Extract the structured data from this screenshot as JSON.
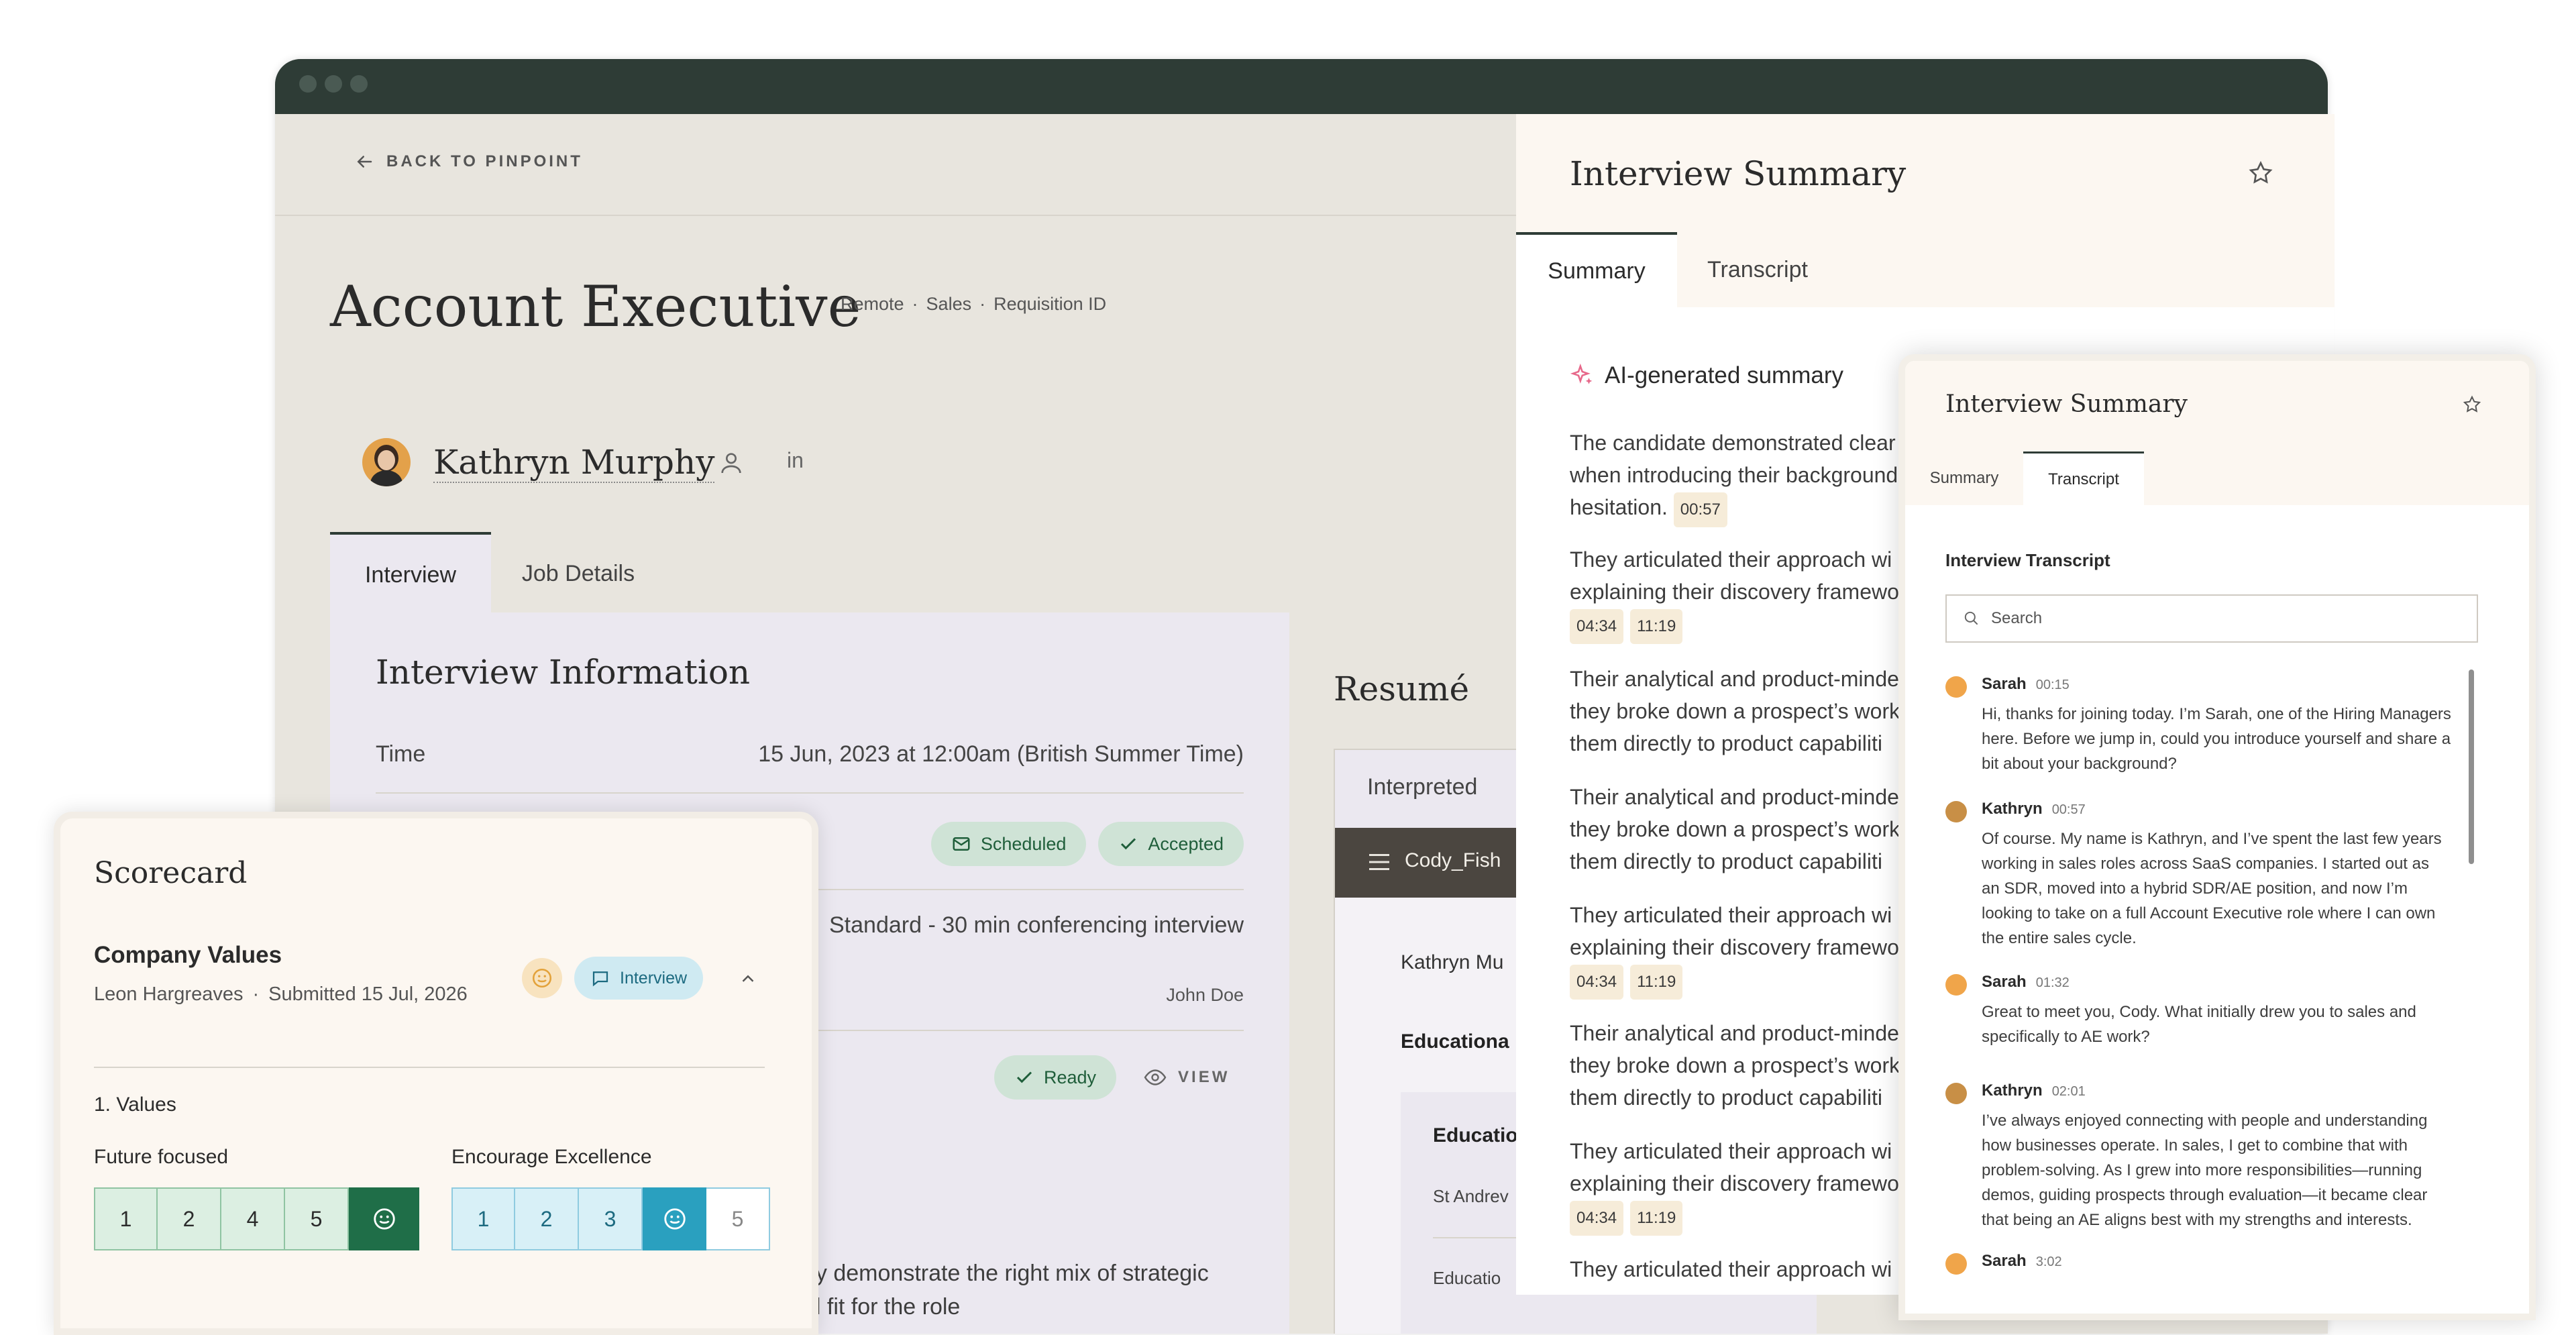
{
  "nav": {
    "back_label": "BACK TO PINPOINT"
  },
  "job": {
    "title": "Account Executive",
    "meta": [
      "Remote",
      "Sales",
      "Requisition ID"
    ]
  },
  "candidate": {
    "name": "Kathryn Murphy",
    "linkedin": "in"
  },
  "tabs": [
    "Interview",
    "Job Details"
  ],
  "interview_info": {
    "title": "Interview Information",
    "time_label": "Time",
    "time_value": "15 Jun, 2023 at 12:00am (British Summer Time)",
    "status_scheduled": "Scheduled",
    "status_accepted": "Accepted",
    "format_value": "Standard - 30 min conferencing interview",
    "interviewer": "John Doe",
    "ready_label": "Ready",
    "view_label": "VIEW",
    "partial_line1": "ey demonstrate the right mix of strategic",
    "partial_line2": "al fit for the role"
  },
  "resume": {
    "title": "Resumé",
    "tab": "Interpreted",
    "file": "Cody_Fish",
    "row1": "Kathryn Mu",
    "row2": "Educationa",
    "edu_head": "Educatio",
    "edu_row": "St Andrev",
    "edu_row2": "Educatio"
  },
  "summary_panel": {
    "title": "Interview Summary",
    "tabs": [
      "Summary",
      "Transcript"
    ],
    "ai_label": "AI-generated summary",
    "paragraphs": [
      {
        "lines": [
          "The candidate demonstrated clear",
          "when introducing their background",
          "hesitation."
        ],
        "times": [
          "00:57"
        ]
      },
      {
        "lines": [
          "They articulated their approach wi",
          "explaining their discovery framewo"
        ],
        "times": [
          "04:34",
          "11:19"
        ]
      },
      {
        "lines": [
          "Their analytical and product-minde",
          "they broke down a prospect’s work",
          "them directly to product capabiliti"
        ],
        "times": []
      },
      {
        "lines": [
          "Their analytical and product-minde",
          "they broke down a prospect’s work",
          "them directly to product capabiliti"
        ],
        "times": []
      },
      {
        "lines": [
          "They articulated their approach wi",
          "explaining their discovery framewo"
        ],
        "times": [
          "04:34",
          "11:19"
        ]
      },
      {
        "lines": [
          "Their analytical and product-minde",
          "they broke down a prospect’s work",
          "them directly to product capabiliti"
        ],
        "times": []
      },
      {
        "lines": [
          "They articulated their approach wi",
          "explaining their discovery framewo"
        ],
        "times": [
          "04:34",
          "11:19"
        ]
      },
      {
        "lines": [
          "They articulated their approach wi"
        ],
        "times": []
      }
    ]
  },
  "transcript_panel": {
    "title": "Interview Summary",
    "tabs": [
      "Summary",
      "Transcript"
    ],
    "heading": "Interview Transcript",
    "search_placeholder": "Search",
    "messages": [
      {
        "speaker": "Sarah",
        "time": "00:15",
        "text": "Hi, thanks for joining today. I’m Sarah, one of the Hiring Managers here. Before we jump in, could you introduce yourself and share a bit about your background?"
      },
      {
        "speaker": "Kathryn",
        "time": "00:57",
        "text": "Of course. My name is Kathryn, and I’ve spent the last few years working in sales roles across SaaS companies. I started out as an SDR, moved into a hybrid SDR/AE position, and now I’m looking to take on a full Account Executive role where I can own the entire sales cycle."
      },
      {
        "speaker": "Sarah",
        "time": "01:32",
        "text": "Great to meet you, Cody. What initially drew you to sales and specifically to AE work?"
      },
      {
        "speaker": "Kathryn",
        "time": "02:01",
        "text": "I’ve always enjoyed connecting with people and understanding how businesses operate. In sales, I get to combine that with problem-solving. As I grew into more responsibilities—running demos, guiding prospects through evaluation—it became clear that being an AE aligns best with my strengths and interests."
      },
      {
        "speaker": "Sarah",
        "time": "3:02",
        "text": ""
      }
    ]
  },
  "scorecard": {
    "title": "Scorecard",
    "section": "Company Values",
    "reviewer": "Leon Hargreaves",
    "submitted": "Submitted 15 Jul, 2026",
    "badge": "Interview",
    "group": "1. Values",
    "criteria": [
      {
        "label": "Future focused",
        "scores": [
          "1",
          "2",
          "4",
          "5"
        ],
        "selected": "smiley"
      },
      {
        "label": "Encourage Excellence",
        "scores": [
          "1",
          "2",
          "3",
          "smiley",
          "5"
        ],
        "selected": "smiley"
      }
    ]
  },
  "colors": {
    "titlebar": "#2e3c36",
    "green_chip": "#cfe3d6",
    "teal_select": "#2aa0bf",
    "green_select": "#1f6e48"
  }
}
